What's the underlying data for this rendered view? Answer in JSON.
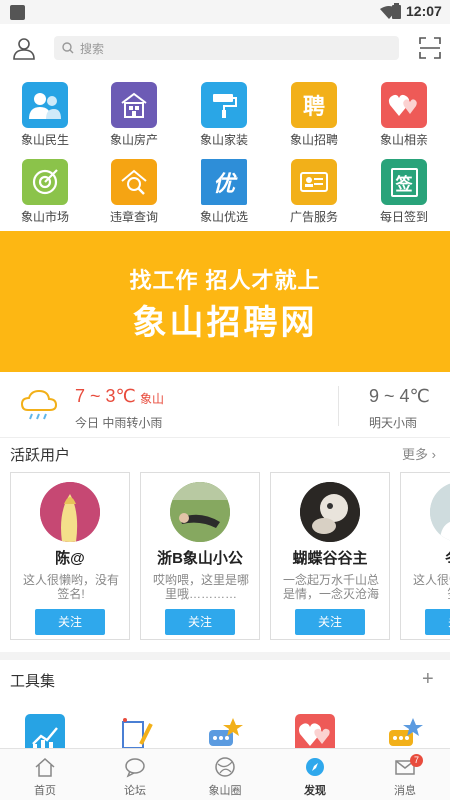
{
  "status_bar": {
    "time": "12:07"
  },
  "header": {
    "search_placeholder": "搜索"
  },
  "grid": [
    {
      "label": "象山民生",
      "icon": "people-icon",
      "color": "#27a3e4"
    },
    {
      "label": "象山房产",
      "icon": "building-icon",
      "color": "#6c5bb5"
    },
    {
      "label": "象山家装",
      "icon": "paint-roller-icon",
      "color": "#2aa6e6"
    },
    {
      "label": "象山招聘",
      "icon": "recruit-icon",
      "color": "#f2b019",
      "glyph": "聘"
    },
    {
      "label": "象山相亲",
      "icon": "hearts-icon",
      "color": "#ee5a57"
    },
    {
      "label": "象山市场",
      "icon": "target-icon",
      "color": "#8bc34a"
    },
    {
      "label": "违章查询",
      "icon": "car-search-icon",
      "color": "#f5a413"
    },
    {
      "label": "象山优选",
      "icon": "you-xuan-icon",
      "color": "#2e8ed8",
      "glyph": "优"
    },
    {
      "label": "广告服务",
      "icon": "ad-card-icon",
      "color": "#f2b019"
    },
    {
      "label": "每日签到",
      "icon": "calendar-sign-icon",
      "color": "#29a37a",
      "glyph": "签"
    }
  ],
  "banner": {
    "line1": "找工作 招人才就上",
    "line2": "象山招聘网",
    "color": "#fdb713"
  },
  "weather": {
    "today_temp": "7 ~ 3℃",
    "city": "象山",
    "today_desc": "今日 中雨转小雨",
    "tomorrow_temp": "9 ~ 4℃",
    "tomorrow_desc": "明天小雨"
  },
  "active_users": {
    "title": "活跃用户",
    "more": "更多",
    "users": [
      {
        "name": "陈@",
        "bio": "这人很懒哟，没有签名!",
        "follow": "关注"
      },
      {
        "name": "浙B象山小公",
        "bio": "哎哟喂，这里是哪里哦…………",
        "follow": "关注"
      },
      {
        "name": "蝴蝶谷谷主",
        "bio": "一念起万水千山总是情，一念灭沧海",
        "follow": "关注"
      },
      {
        "name": "冬天",
        "bio": "这人很懒哟，没有签名!",
        "follow": "关注"
      }
    ]
  },
  "tools": {
    "title": "工具集",
    "add": "+"
  },
  "tabbar": {
    "tabs": [
      {
        "label": "首页",
        "icon": "home-icon"
      },
      {
        "label": "论坛",
        "icon": "chat-icon"
      },
      {
        "label": "象山圈",
        "icon": "circle-icon"
      },
      {
        "label": "发现",
        "icon": "compass-icon",
        "active": true
      },
      {
        "label": "消息",
        "icon": "mail-icon",
        "badge": "7"
      }
    ]
  }
}
